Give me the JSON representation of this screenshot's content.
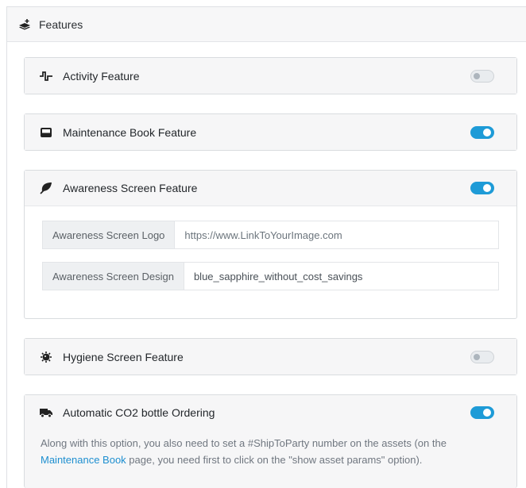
{
  "panel": {
    "title": "Features",
    "icon": "layers-plus-icon"
  },
  "features": {
    "activity": {
      "label": "Activity Feature",
      "icon": "pulse-icon",
      "enabled": false
    },
    "maintenance_book": {
      "label": "Maintenance Book Feature",
      "icon": "inbox-tray-icon",
      "enabled": true
    },
    "awareness_screen": {
      "label": "Awareness Screen Feature",
      "icon": "leaf-icon",
      "enabled": true,
      "logo": {
        "label": "Awareness Screen Logo",
        "placeholder": "https://www.LinkToYourImage.com"
      },
      "design": {
        "label": "Awareness Screen Design",
        "value": "blue_sapphire_without_cost_savings"
      }
    },
    "hygiene_screen": {
      "label": "Hygiene Screen Feature",
      "icon": "virus-icon",
      "enabled": false
    },
    "co2_ordering": {
      "label": "Automatic CO2 bottle Ordering",
      "icon": "truck-icon",
      "enabled": true,
      "desc_before": "Along with this option, you also need to set a #ShipToParty number on the assets (on the ",
      "desc_link": "Maintenance Book",
      "desc_after": " page, you need first to click on the \"show asset params\" option)."
    }
  },
  "colors": {
    "toggle_on": "#1e9bd7",
    "link": "#1e8fd0"
  }
}
